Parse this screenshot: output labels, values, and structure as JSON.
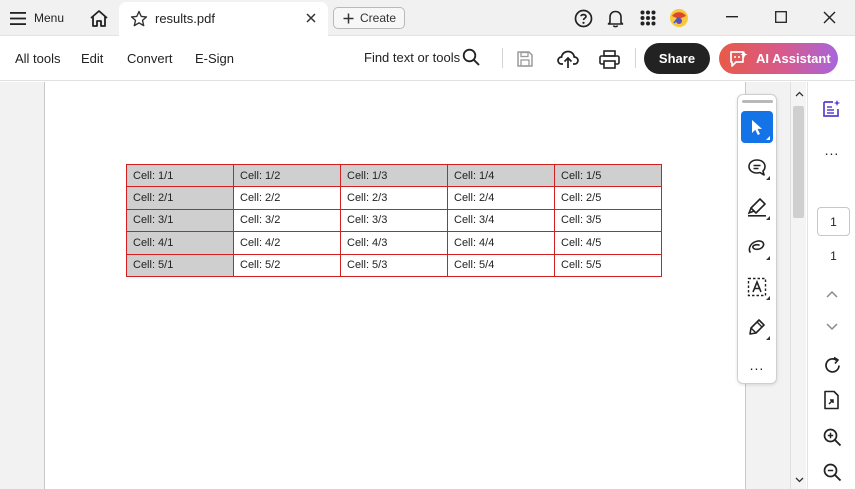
{
  "tabbar": {
    "menu_label": "Menu",
    "tab_title": "results.pdf",
    "create_label": "Create"
  },
  "toolbar": {
    "menus": [
      "All tools",
      "Edit",
      "Convert",
      "E-Sign"
    ],
    "find_label": "Find text or tools",
    "share_label": "Share",
    "ai_label": "AI Assistant",
    "colors": {
      "share_bg": "#222222",
      "ai_gradient": [
        "#e85a48",
        "#d65a8e",
        "#a865dc"
      ],
      "active_tool": "#1473e6"
    }
  },
  "table": {
    "rows": [
      [
        "Cell: 1/1",
        "Cell: 1/2",
        "Cell: 1/3",
        "Cell: 1/4",
        "Cell: 1/5"
      ],
      [
        "Cell: 2/1",
        "Cell: 2/2",
        "Cell: 2/3",
        "Cell: 2/4",
        "Cell: 2/5"
      ],
      [
        "Cell: 3/1",
        "Cell: 3/2",
        "Cell: 3/3",
        "Cell: 3/4",
        "Cell: 3/5"
      ],
      [
        "Cell: 4/1",
        "Cell: 4/2",
        "Cell: 4/3",
        "Cell: 4/4",
        "Cell: 4/5"
      ],
      [
        "Cell: 5/1",
        "Cell: 5/2",
        "Cell: 5/3",
        "Cell: 5/4",
        "Cell: 5/5"
      ]
    ],
    "border_color": "#d21f1f",
    "header_fill": "#cfcfcf"
  },
  "rail": {
    "tools": [
      "select-cursor-icon",
      "comment-icon",
      "highlighter-icon",
      "draw-loop-icon",
      "text-select-icon",
      "sign-pen-icon",
      "more-tools-icon"
    ],
    "more_label": "..."
  },
  "right_panel": {
    "current_page": "1",
    "total_pages": "1",
    "more_label": "..."
  }
}
